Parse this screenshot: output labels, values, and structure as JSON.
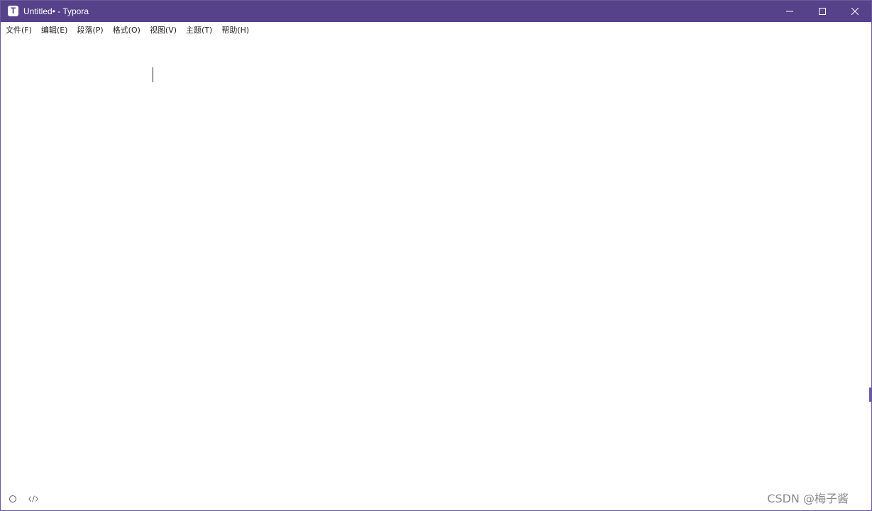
{
  "window": {
    "title": "Untitled• - Typora",
    "app_icon_letter": "T"
  },
  "title_controls": {
    "minimize_icon": "minimize-icon",
    "maximize_icon": "maximize-icon",
    "close_icon": "close-icon"
  },
  "menubar": {
    "items": [
      {
        "label": "文件(F)"
      },
      {
        "label": "编辑(E)"
      },
      {
        "label": "段落(P)"
      },
      {
        "label": "格式(O)"
      },
      {
        "label": "视图(V)"
      },
      {
        "label": "主题(T)"
      },
      {
        "label": "帮助(H)"
      }
    ]
  },
  "editor": {
    "content": ""
  },
  "statusbar": {
    "outline_icon": "circle-icon",
    "source_icon": "code-icon",
    "watermark": "CSDN @梅子酱"
  },
  "colors": {
    "titlebar": "#56428a",
    "text": "#222222"
  }
}
